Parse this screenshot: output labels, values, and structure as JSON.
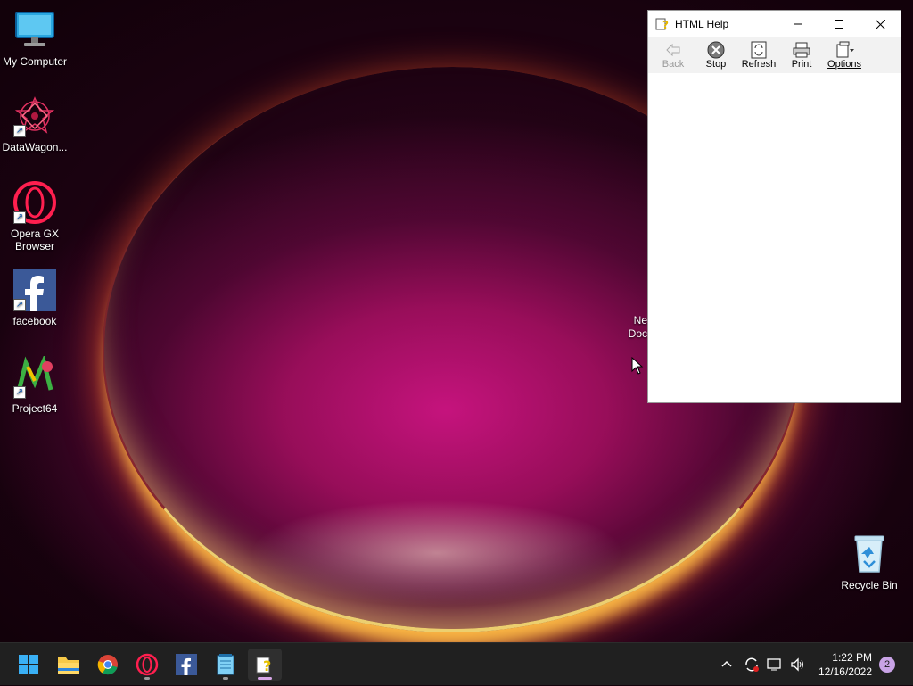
{
  "desktop": {
    "icons": [
      {
        "label": "My Computer",
        "icon": "monitor-icon"
      },
      {
        "label": "DataWagon...",
        "icon": "mandala-icon"
      },
      {
        "label": "Opera GX Browser",
        "icon": "opera-gx-icon"
      },
      {
        "label": "facebook",
        "icon": "facebook-icon"
      },
      {
        "label": "Project64",
        "icon": "project64-icon"
      },
      {
        "label": "Recycle Bin",
        "icon": "recycle-bin-icon"
      }
    ],
    "hidden_icon_label": "Ne Doc"
  },
  "window": {
    "title": "HTML Help",
    "toolbar": {
      "back": "Back",
      "stop": "Stop",
      "refresh": "Refresh",
      "print": "Print",
      "options": "Options"
    }
  },
  "taskbar": {
    "apps": [
      "start-icon",
      "file-explorer-icon",
      "chrome-icon",
      "opera-gx-icon",
      "facebook-icon",
      "notepad-icon",
      "html-help-icon"
    ],
    "clock": {
      "time": "1:22 PM",
      "date": "12/16/2022"
    },
    "notifications": "2"
  },
  "colors": {
    "accent": "#c9a3e6",
    "taskbar": "#202020"
  }
}
